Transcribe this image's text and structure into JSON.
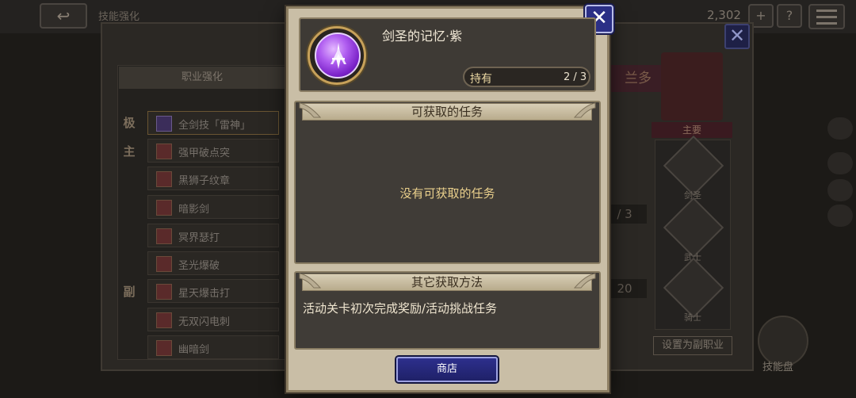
{
  "background": {
    "window_title": "技能强化",
    "currency_count": "2,302",
    "list_header": "职业强化",
    "tags": [
      "极",
      "主",
      "副"
    ],
    "skills": [
      {
        "label": "全剑技「雷神」",
        "locked": false
      },
      {
        "label": "强甲破点突",
        "locked": false
      },
      {
        "label": "黑狮子纹章",
        "locked": false
      },
      {
        "label": "暗影剑",
        "locked": true
      },
      {
        "label": "冥界瑟打",
        "locked": true
      },
      {
        "label": "圣光爆破",
        "locked": true
      },
      {
        "label": "星天爆击打",
        "locked": false
      },
      {
        "label": "无双闪电刺",
        "locked": false
      },
      {
        "label": "幽暗剑",
        "locked": false
      }
    ],
    "character_name": "兰多",
    "main_label": "主要",
    "classes": [
      "剑圣",
      "武士",
      "骑士"
    ],
    "mid_values": [
      "/ 3",
      "20"
    ],
    "set_sub_button": "设置为副职业",
    "skill_board": "技能盘"
  },
  "modal": {
    "close_icon": "✕",
    "item": {
      "name": "剑圣的记忆·紫",
      "icon": "purple-sword-orb-icon",
      "own_label": "持有",
      "own_value": "2 / 3"
    },
    "quests": {
      "title": "可获取的任务",
      "empty_message": "没有可获取的任务"
    },
    "other": {
      "title": "其它获取方法",
      "text": "活动关卡初次完成奖励/活动挑战任务"
    },
    "shop_button": "商店"
  },
  "colors": {
    "modal_bg": "#c9bea6",
    "section_bg": "#403c37",
    "button_blue": "#2b2f86",
    "accent_gold": "#ead08c",
    "orb_purple": "#b05ef0"
  }
}
